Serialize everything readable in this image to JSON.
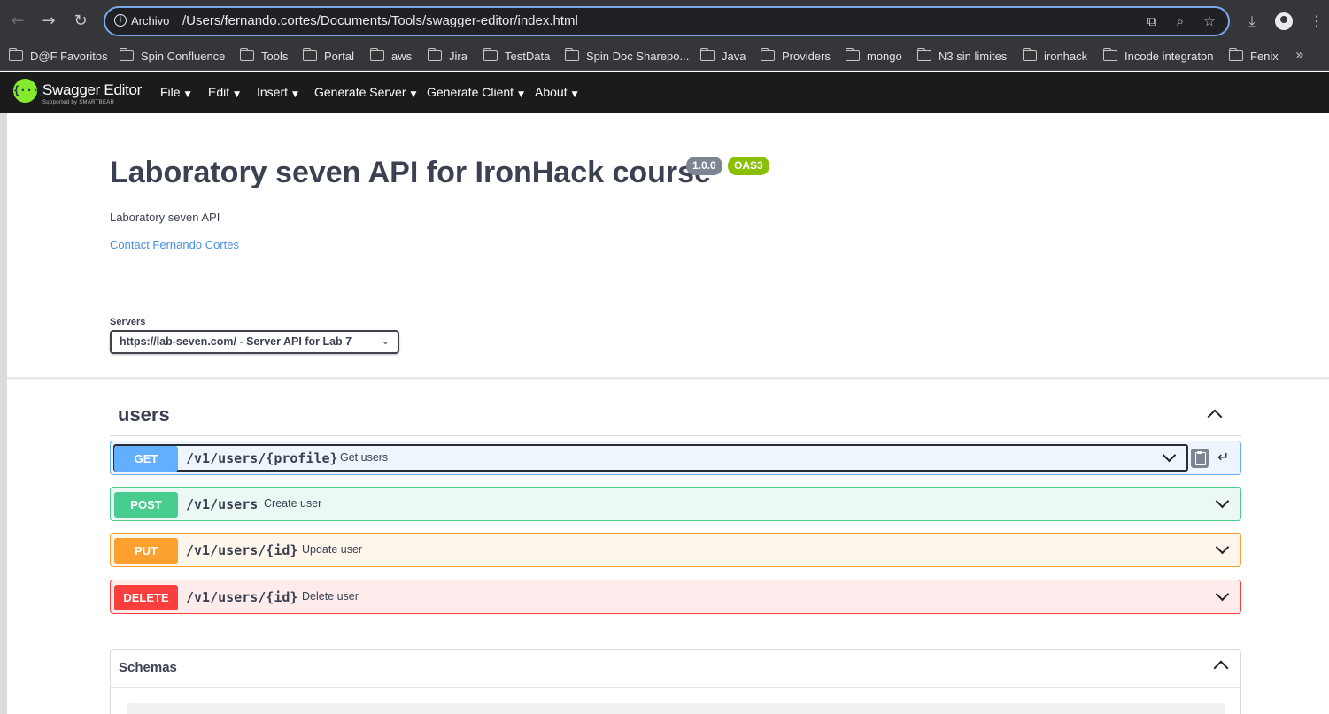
{
  "browser": {
    "omnibox_scheme": "Archivo",
    "url": "/Users/fernando.cortes/Documents/Tools/swagger-editor/index.html",
    "bookmarks": [
      "D@F Favoritos",
      "Spin Confluence",
      "Tools",
      "Portal",
      "aws",
      "Jira",
      "TestData",
      "Spin Doc Sharepo...",
      "Java",
      "Providers",
      "mongo",
      "N3 sin limites",
      "ironhack",
      "Incode integraton",
      "Fenix"
    ]
  },
  "editor": {
    "name": "Swagger Editor",
    "logo_text": "{···}",
    "tagline": "Supported by SMARTBEAR",
    "menu": [
      "File",
      "Edit",
      "Insert",
      "Generate Server",
      "Generate Client",
      "About"
    ]
  },
  "info": {
    "title": "Laboratory seven API for IronHack course",
    "version": "1.0.0",
    "oas": "OAS3",
    "description": "Laboratory seven API",
    "contact": "Contact Fernando Cortes"
  },
  "servers": {
    "label": "Servers",
    "selected": "https://lab-seven.com/ - Server API for Lab 7"
  },
  "tag": {
    "name": "users",
    "operations": [
      {
        "method": "GET",
        "path": "/v1/users/{profile}",
        "summary": "Get users"
      },
      {
        "method": "POST",
        "path": "/v1/users",
        "summary": "Create user"
      },
      {
        "method": "PUT",
        "path": "/v1/users/{id}",
        "summary": "Update user"
      },
      {
        "method": "DELETE",
        "path": "/v1/users/{id}",
        "summary": "Delete user"
      }
    ]
  },
  "schemas": {
    "title": "Schemas"
  },
  "colors": {
    "get": "#61affe",
    "post": "#49cc90",
    "put": "#fca130",
    "delete": "#f93e3e",
    "brand": "#85ea2d"
  },
  "icons": [
    "back-icon",
    "forward-icon",
    "reload-icon",
    "info-icon",
    "translate-icon",
    "zoom-icon",
    "star-icon",
    "download-icon",
    "profile-icon",
    "kebab-icon",
    "folder-icon",
    "copy-icon",
    "enter-icon",
    "chevron-icon"
  ]
}
